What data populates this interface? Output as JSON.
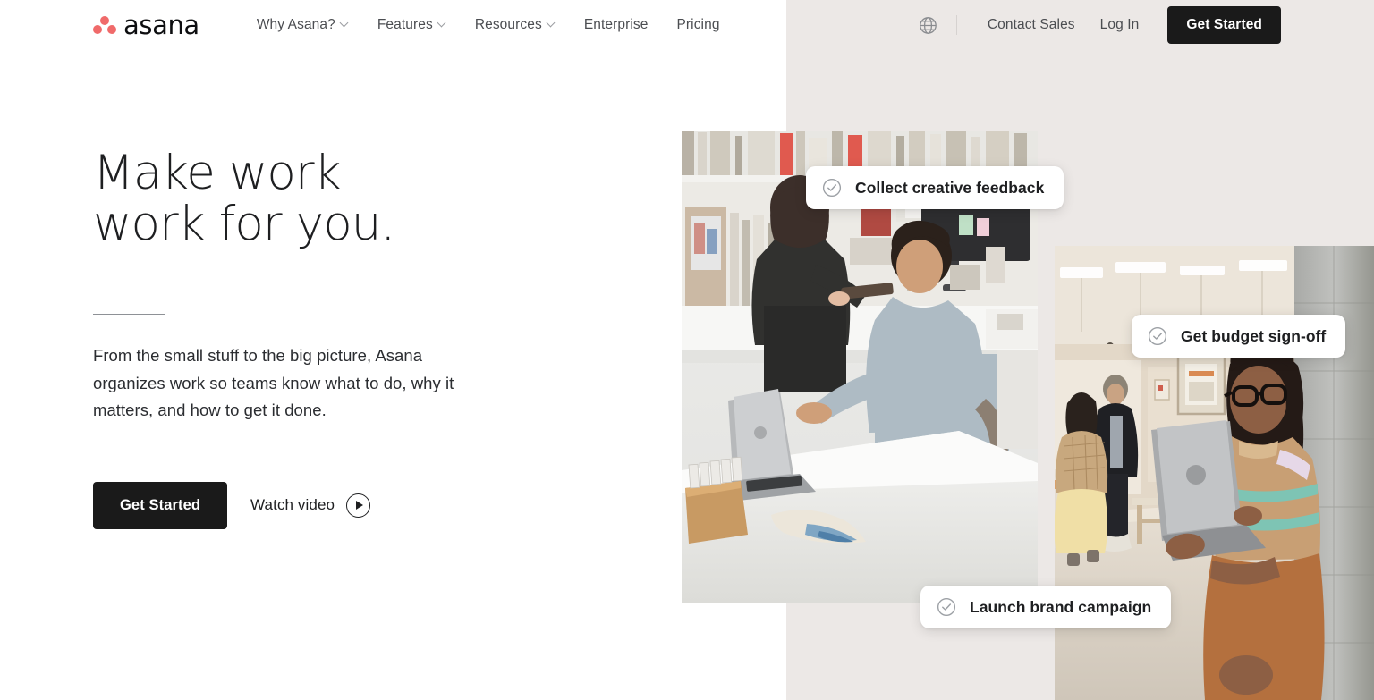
{
  "brand": {
    "name": "asana",
    "logo_icon": "asana-dots-logo",
    "accent_color": "#f06a6a",
    "dark_color": "#1a1a1a"
  },
  "nav": {
    "links": [
      {
        "label": "Why Asana?",
        "has_dropdown": true,
        "icon": "chevron-down-icon"
      },
      {
        "label": "Features",
        "has_dropdown": true,
        "icon": "chevron-down-icon"
      },
      {
        "label": "Resources",
        "has_dropdown": true,
        "icon": "chevron-down-icon"
      },
      {
        "label": "Enterprise",
        "has_dropdown": false,
        "icon": ""
      },
      {
        "label": "Pricing",
        "has_dropdown": false,
        "icon": ""
      }
    ],
    "language_icon": "globe-icon",
    "contact_sales": "Contact Sales",
    "log_in": "Log In",
    "get_started": "Get Started"
  },
  "hero": {
    "title": "Make work\nwork for you.",
    "subtitle": "From the small stuff to the big picture, Asana organizes work so teams know what to do, why it matters, and how to get it done.",
    "primary_cta": "Get Started",
    "secondary_cta": "Watch video",
    "play_icon": "play-circle-icon"
  },
  "media": {
    "photo_1_alt": "Two coworkers reviewing materials at a white studio desk with a laptop",
    "photo_2_alt": "Woman with glasses holding a laptop in a bright office corridor"
  },
  "task_cards": [
    {
      "label": "Collect creative feedback",
      "icon": "check-circle-icon"
    },
    {
      "label": "Get budget sign-off",
      "icon": "check-circle-icon"
    },
    {
      "label": "Launch brand campaign",
      "icon": "check-circle-icon"
    }
  ]
}
